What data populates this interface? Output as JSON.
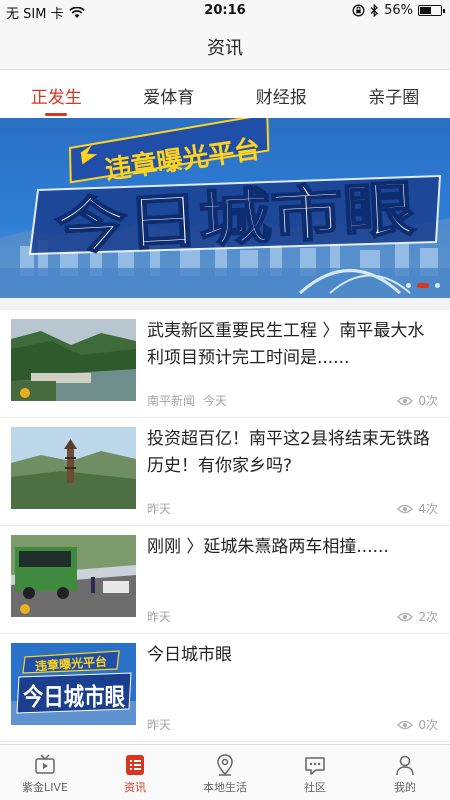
{
  "status_bar": {
    "carrier": "无 SIM 卡",
    "time": "20:16",
    "battery": "56%",
    "battery_level": 0.56
  },
  "nav": {
    "title": "资讯"
  },
  "tabs": [
    {
      "label": "正发生",
      "active": true
    },
    {
      "label": "爱体育",
      "active": false
    },
    {
      "label": "财经报",
      "active": false
    },
    {
      "label": "亲子圈",
      "active": false
    }
  ],
  "banner": {
    "line1": "违章曝光平台",
    "line2": "今日城市眼",
    "slides": 3,
    "active_slide": 2
  },
  "news": [
    {
      "title": "武夷新区重要民生工程 〉南平最大水利项目预计完工时间是......",
      "source": "南平新闻",
      "time": "今天",
      "views": "0次"
    },
    {
      "title": "投资超百亿！南平这2县将结束无铁路历史！有你家乡吗?",
      "source": "",
      "time": "昨天",
      "views": "4次"
    },
    {
      "title": "刚刚 〉延城朱熹路两车相撞......",
      "source": "",
      "time": "昨天",
      "views": "2次"
    },
    {
      "title": "今日城市眼",
      "source": "",
      "time": "昨天",
      "views": "0次"
    }
  ],
  "thumb_banner": {
    "line1": "违章曝光平台",
    "line2": "今日城市眼"
  },
  "bottom_nav": [
    {
      "label": "紫金LIVE",
      "icon": "tv-icon",
      "active": false
    },
    {
      "label": "资讯",
      "icon": "list-icon",
      "active": true
    },
    {
      "label": "本地生活",
      "icon": "location-pin-icon",
      "active": false
    },
    {
      "label": "社区",
      "icon": "chat-bubble-icon",
      "active": false
    },
    {
      "label": "我的",
      "icon": "person-icon",
      "active": false
    }
  ],
  "colors": {
    "accent": "#d9361f",
    "banner_blue": "#1e5fb8",
    "banner_yellow": "#ffd21f"
  }
}
